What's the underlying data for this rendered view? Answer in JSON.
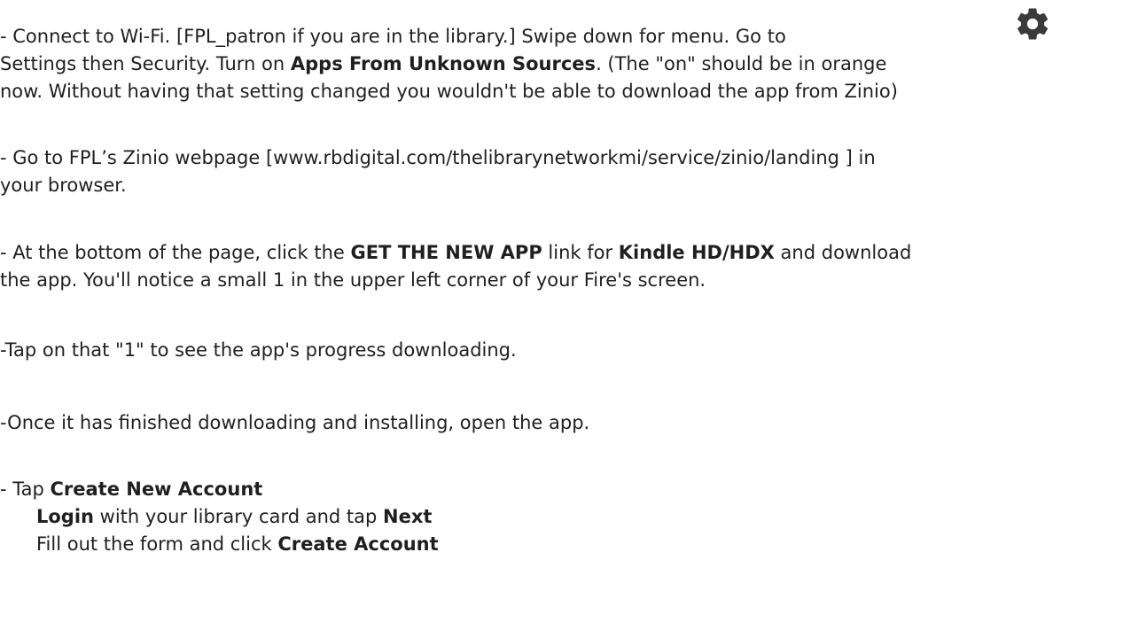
{
  "icon": {
    "name": "gear-icon",
    "color": "#3a3a3a"
  },
  "step1": {
    "l1_a": "- Connect to Wi-Fi. [FPL_patron if you are in the library.]  Swipe down for menu. Go to",
    "l2_a": "Settings then Security. Turn on ",
    "l2_b": "Apps From Unknown Sources",
    "l2_c": ". (The \"on\" should be in orange",
    "l3_a": "now. Without having that setting changed you wouldn't be able to download the app from Zinio)"
  },
  "step2": {
    "l1_a": "- Go to FPL’s Zinio webpage [www.rbdigital.com/thelibrarynetworkmi/service/zinio/landing ] in",
    "l2_a": "your browser."
  },
  "step3": {
    "l1_a": "-  At the bottom of the page, click the ",
    "l1_b": "GET THE NEW APP",
    "l1_c": " link for ",
    "l1_d": "Kindle HD/HDX",
    "l1_e": " and download",
    "l2_a": "the app. You'll notice a small 1 in the upper left corner of your Fire's screen."
  },
  "step4": {
    "l1_a": "-Tap on that \"1\" to see the app's progress downloading."
  },
  "step5": {
    "l1_a": "-Once it has finished downloading and installing, open the app."
  },
  "step6": {
    "l1_a": "- Tap ",
    "l1_b": "Create New Account",
    "l2_b": "Login",
    "l2_c": " with your library card and tap ",
    "l2_d": "Next",
    "l3_a": "Fill out the form and click ",
    "l3_b": "Create Account"
  }
}
